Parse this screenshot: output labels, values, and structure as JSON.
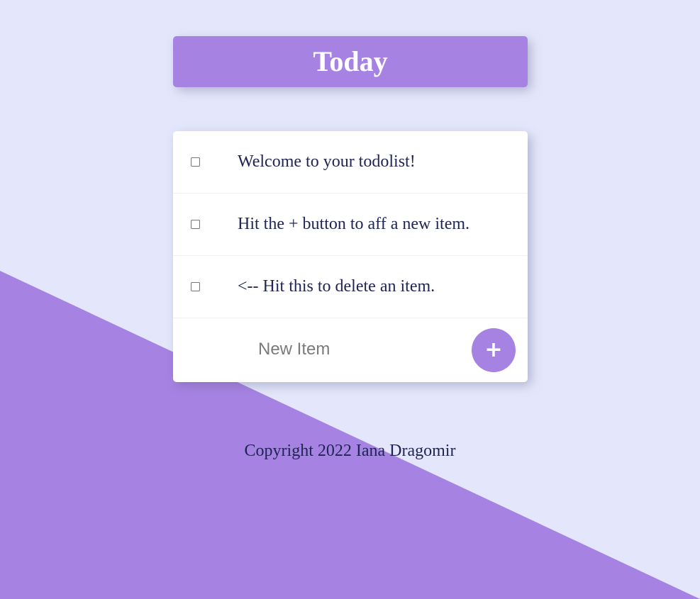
{
  "header": {
    "title": "Today"
  },
  "items": [
    {
      "text": "Welcome to your todolist!",
      "checked": false
    },
    {
      "text": "Hit the + button to aff a new item.",
      "checked": false
    },
    {
      "text": "<-- Hit this to delete an item.",
      "checked": false
    }
  ],
  "new_item": {
    "placeholder": "New Item",
    "value": ""
  },
  "add_button": {
    "label": "+"
  },
  "footer": {
    "text": "Copyright 2022 Iana Dragomir"
  },
  "colors": {
    "background": "#e4e7fc",
    "accent": "#a683e3",
    "text": "#1f2453"
  }
}
